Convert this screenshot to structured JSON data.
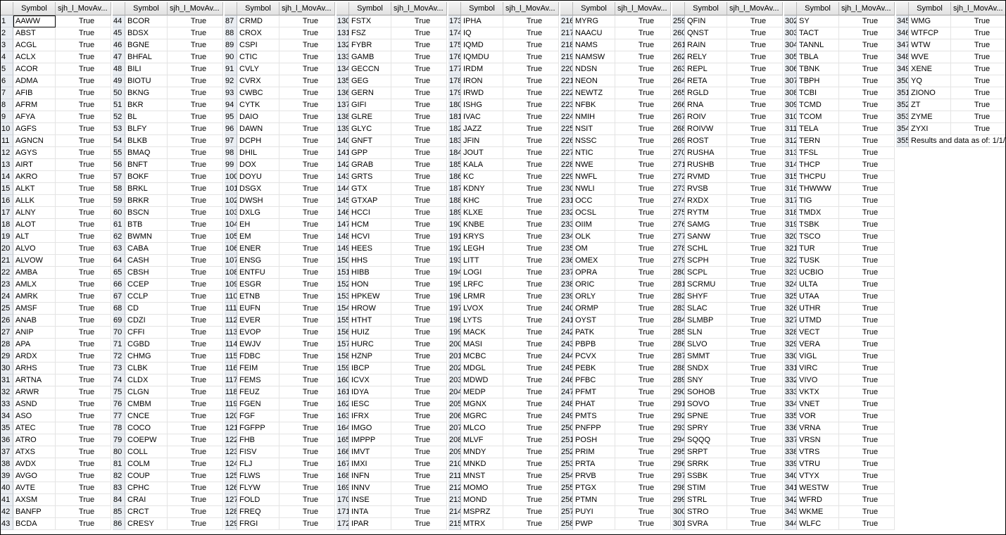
{
  "sheet": {
    "columns": {
      "symbol": "Symbol",
      "metric": "sjh_l_MovAv..."
    },
    "true_value": "True",
    "rows": [
      [
        "1",
        "AAWW"
      ],
      [
        "2",
        "ABST"
      ],
      [
        "3",
        "ACGL"
      ],
      [
        "4",
        "ACLX"
      ],
      [
        "5",
        "ACOR"
      ],
      [
        "6",
        "ADMA"
      ],
      [
        "7",
        "AFIB"
      ],
      [
        "8",
        "AFRM"
      ],
      [
        "9",
        "AFYA"
      ],
      [
        "10",
        "AGFS"
      ],
      [
        "11",
        "AGNCN"
      ],
      [
        "12",
        "AGYS"
      ],
      [
        "13",
        "AIRT"
      ],
      [
        "14",
        "AKRO"
      ],
      [
        "15",
        "ALKT"
      ],
      [
        "16",
        "ALLK"
      ],
      [
        "17",
        "ALNY"
      ],
      [
        "18",
        "ALOT"
      ],
      [
        "19",
        "ALT"
      ],
      [
        "20",
        "ALVO"
      ],
      [
        "21",
        "ALVOW"
      ],
      [
        "22",
        "AMBA"
      ],
      [
        "23",
        "AMLX"
      ],
      [
        "24",
        "AMRK"
      ],
      [
        "25",
        "AMSF"
      ],
      [
        "26",
        "ANAB"
      ],
      [
        "27",
        "ANIP"
      ],
      [
        "28",
        "APA"
      ],
      [
        "29",
        "ARDX"
      ],
      [
        "30",
        "ARHS"
      ],
      [
        "31",
        "ARTNA"
      ],
      [
        "32",
        "ARWR"
      ],
      [
        "33",
        "ASND"
      ],
      [
        "34",
        "ASO"
      ],
      [
        "35",
        "ATEC"
      ],
      [
        "36",
        "ATRO"
      ],
      [
        "37",
        "ATXS"
      ],
      [
        "38",
        "AVDX"
      ],
      [
        "39",
        "AVGO"
      ],
      [
        "40",
        "AVTE"
      ],
      [
        "41",
        "AXSM"
      ],
      [
        "42",
        "BANFP"
      ],
      [
        "43",
        "BCDA"
      ],
      [
        "44",
        "BCOR"
      ],
      [
        "45",
        "BDSX"
      ],
      [
        "46",
        "BGNE"
      ],
      [
        "47",
        "BHFAL"
      ],
      [
        "48",
        "BILI"
      ],
      [
        "49",
        "BIOTU"
      ],
      [
        "50",
        "BKNG"
      ],
      [
        "51",
        "BKR"
      ],
      [
        "52",
        "BL"
      ],
      [
        "53",
        "BLFY"
      ],
      [
        "54",
        "BLKB"
      ],
      [
        "55",
        "BMAQ"
      ],
      [
        "56",
        "BNFT"
      ],
      [
        "57",
        "BOKF"
      ],
      [
        "58",
        "BRKL"
      ],
      [
        "59",
        "BRKR"
      ],
      [
        "60",
        "BSCN"
      ],
      [
        "61",
        "BTB"
      ],
      [
        "62",
        "BWMN"
      ],
      [
        "63",
        "CABA"
      ],
      [
        "64",
        "CASH"
      ],
      [
        "65",
        "CBSH"
      ],
      [
        "66",
        "CCEP"
      ],
      [
        "67",
        "CCLP"
      ],
      [
        "68",
        "CD"
      ],
      [
        "69",
        "CDZI"
      ],
      [
        "70",
        "CFFI"
      ],
      [
        "71",
        "CGBD"
      ],
      [
        "72",
        "CHMG"
      ],
      [
        "73",
        "CLBK"
      ],
      [
        "74",
        "CLDX"
      ],
      [
        "75",
        "CLGN"
      ],
      [
        "76",
        "CMBM"
      ],
      [
        "77",
        "CNCE"
      ],
      [
        "78",
        "COCO"
      ],
      [
        "79",
        "COEPW"
      ],
      [
        "80",
        "COLL"
      ],
      [
        "81",
        "COLM"
      ],
      [
        "82",
        "COUP"
      ],
      [
        "83",
        "CPHC"
      ],
      [
        "84",
        "CRAI"
      ],
      [
        "85",
        "CRCT"
      ],
      [
        "86",
        "CRESY"
      ],
      [
        "87",
        "CRMD"
      ],
      [
        "88",
        "CROX"
      ],
      [
        "89",
        "CSPI"
      ],
      [
        "90",
        "CTIC"
      ],
      [
        "91",
        "CVLY"
      ],
      [
        "92",
        "CVRX"
      ],
      [
        "93",
        "CWBC"
      ],
      [
        "94",
        "CYTK"
      ],
      [
        "95",
        "DAIO"
      ],
      [
        "96",
        "DAWN"
      ],
      [
        "97",
        "DCPH"
      ],
      [
        "98",
        "DHIL"
      ],
      [
        "99",
        "DOX"
      ],
      [
        "100",
        "DOYU"
      ],
      [
        "101",
        "DSGX"
      ],
      [
        "102",
        "DWSH"
      ],
      [
        "103",
        "DXLG"
      ],
      [
        "104",
        "EH"
      ],
      [
        "105",
        "EM"
      ],
      [
        "106",
        "ENER"
      ],
      [
        "107",
        "ENSG"
      ],
      [
        "108",
        "ENTFU"
      ],
      [
        "109",
        "ESGR"
      ],
      [
        "110",
        "ETNB"
      ],
      [
        "111",
        "EUFN"
      ],
      [
        "112",
        "EVER"
      ],
      [
        "113",
        "EVOP"
      ],
      [
        "114",
        "EWJV"
      ],
      [
        "115",
        "FDBC"
      ],
      [
        "116",
        "FEIM"
      ],
      [
        "117",
        "FEMS"
      ],
      [
        "118",
        "FEUZ"
      ],
      [
        "119",
        "FGEN"
      ],
      [
        "120",
        "FGF"
      ],
      [
        "121",
        "FGFPP"
      ],
      [
        "122",
        "FHB"
      ],
      [
        "123",
        "FISV"
      ],
      [
        "124",
        "FLJ"
      ],
      [
        "125",
        "FLWS"
      ],
      [
        "126",
        "FLYW"
      ],
      [
        "127",
        "FOLD"
      ],
      [
        "128",
        "FREQ"
      ],
      [
        "129",
        "FRGI"
      ],
      [
        "130",
        "FSTX"
      ],
      [
        "131",
        "FSZ"
      ],
      [
        "132",
        "FYBR"
      ],
      [
        "133",
        "GAMB"
      ],
      [
        "134",
        "GECCN"
      ],
      [
        "135",
        "GEG"
      ],
      [
        "136",
        "GERN"
      ],
      [
        "137",
        "GIFI"
      ],
      [
        "138",
        "GLRE"
      ],
      [
        "139",
        "GLYC"
      ],
      [
        "140",
        "GNFT"
      ],
      [
        "141",
        "GPP"
      ],
      [
        "142",
        "GRAB"
      ],
      [
        "143",
        "GRTS"
      ],
      [
        "144",
        "GTX"
      ],
      [
        "145",
        "GTXAP"
      ],
      [
        "146",
        "HCCI"
      ],
      [
        "147",
        "HCM"
      ],
      [
        "148",
        "HCVI"
      ],
      [
        "149",
        "HEES"
      ],
      [
        "150",
        "HHS"
      ],
      [
        "151",
        "HIBB"
      ],
      [
        "152",
        "HON"
      ],
      [
        "153",
        "HPKEW"
      ],
      [
        "154",
        "HROW"
      ],
      [
        "155",
        "HTHT"
      ],
      [
        "156",
        "HUIZ"
      ],
      [
        "157",
        "HURC"
      ],
      [
        "158",
        "HZNP"
      ],
      [
        "159",
        "IBCP"
      ],
      [
        "160",
        "ICVX"
      ],
      [
        "161",
        "IDYA"
      ],
      [
        "162",
        "IESC"
      ],
      [
        "163",
        "IFRX"
      ],
      [
        "164",
        "IMGO"
      ],
      [
        "165",
        "IMPPP"
      ],
      [
        "166",
        "IMVT"
      ],
      [
        "167",
        "IMXI"
      ],
      [
        "168",
        "INFN"
      ],
      [
        "169",
        "INNV"
      ],
      [
        "170",
        "INSE"
      ],
      [
        "171",
        "INTA"
      ],
      [
        "172",
        "IPAR"
      ],
      [
        "173",
        "IPHA"
      ],
      [
        "174",
        "IQ"
      ],
      [
        "175",
        "IQMD"
      ],
      [
        "176",
        "IQMDU"
      ],
      [
        "177",
        "IRDM"
      ],
      [
        "178",
        "IRON"
      ],
      [
        "179",
        "IRWD"
      ],
      [
        "180",
        "ISHG"
      ],
      [
        "181",
        "IVAC"
      ],
      [
        "182",
        "JAZZ"
      ],
      [
        "183",
        "JFIN"
      ],
      [
        "184",
        "JOUT"
      ],
      [
        "185",
        "KALA"
      ],
      [
        "186",
        "KC"
      ],
      [
        "187",
        "KDNY"
      ],
      [
        "188",
        "KHC"
      ],
      [
        "189",
        "KLXE"
      ],
      [
        "190",
        "KNBE"
      ],
      [
        "191",
        "KRYS"
      ],
      [
        "192",
        "LEGH"
      ],
      [
        "193",
        "LITT"
      ],
      [
        "194",
        "LOGI"
      ],
      [
        "195",
        "LRFC"
      ],
      [
        "196",
        "LRMR"
      ],
      [
        "197",
        "LVOX"
      ],
      [
        "198",
        "LYTS"
      ],
      [
        "199",
        "MACK"
      ],
      [
        "200",
        "MASI"
      ],
      [
        "201",
        "MCBC"
      ],
      [
        "202",
        "MDGL"
      ],
      [
        "203",
        "MDWD"
      ],
      [
        "204",
        "MEDP"
      ],
      [
        "205",
        "MGNX"
      ],
      [
        "206",
        "MGRC"
      ],
      [
        "207",
        "MLCO"
      ],
      [
        "208",
        "MLVF"
      ],
      [
        "209",
        "MNDY"
      ],
      [
        "210",
        "MNKD"
      ],
      [
        "211",
        "MNST"
      ],
      [
        "212",
        "MOMO"
      ],
      [
        "213",
        "MOND"
      ],
      [
        "214",
        "MSPRZ"
      ],
      [
        "215",
        "MTRX"
      ],
      [
        "216",
        "MYRG"
      ],
      [
        "217",
        "NAACU"
      ],
      [
        "218",
        "NAMS"
      ],
      [
        "219",
        "NAMSW"
      ],
      [
        "220",
        "NDSN"
      ],
      [
        "221",
        "NEON"
      ],
      [
        "222",
        "NEWTZ"
      ],
      [
        "223",
        "NFBK"
      ],
      [
        "224",
        "NMIH"
      ],
      [
        "225",
        "NSIT"
      ],
      [
        "226",
        "NSSC"
      ],
      [
        "227",
        "NTIC"
      ],
      [
        "228",
        "NWE"
      ],
      [
        "229",
        "NWFL"
      ],
      [
        "230",
        "NWLI"
      ],
      [
        "231",
        "OCC"
      ],
      [
        "232",
        "OCSL"
      ],
      [
        "233",
        "OIIM"
      ],
      [
        "234",
        "OLK"
      ],
      [
        "235",
        "OM"
      ],
      [
        "236",
        "OMEX"
      ],
      [
        "237",
        "OPRA"
      ],
      [
        "238",
        "ORIC"
      ],
      [
        "239",
        "ORLY"
      ],
      [
        "240",
        "ORMP"
      ],
      [
        "241",
        "OYST"
      ],
      [
        "242",
        "PATK"
      ],
      [
        "243",
        "PBPB"
      ],
      [
        "244",
        "PCVX"
      ],
      [
        "245",
        "PEBK"
      ],
      [
        "246",
        "PFBC"
      ],
      [
        "247",
        "PFMT"
      ],
      [
        "248",
        "PHAT"
      ],
      [
        "249",
        "PMTS"
      ],
      [
        "250",
        "PNFPP"
      ],
      [
        "251",
        "POSH"
      ],
      [
        "252",
        "PRIM"
      ],
      [
        "253",
        "PRTA"
      ],
      [
        "254",
        "PRVB"
      ],
      [
        "255",
        "PTGX"
      ],
      [
        "256",
        "PTMN"
      ],
      [
        "257",
        "PUYI"
      ],
      [
        "258",
        "PWP"
      ],
      [
        "259",
        "QFIN"
      ],
      [
        "260",
        "QNST"
      ],
      [
        "261",
        "RAIN"
      ],
      [
        "262",
        "RELY"
      ],
      [
        "263",
        "REPL"
      ],
      [
        "264",
        "RETA"
      ],
      [
        "265",
        "RGLD"
      ],
      [
        "266",
        "RNA"
      ],
      [
        "267",
        "ROIV"
      ],
      [
        "268",
        "ROIVW"
      ],
      [
        "269",
        "ROST"
      ],
      [
        "270",
        "RUSHA"
      ],
      [
        "271",
        "RUSHB"
      ],
      [
        "272",
        "RVMD"
      ],
      [
        "273",
        "RVSB"
      ],
      [
        "274",
        "RXDX"
      ],
      [
        "275",
        "RYTM"
      ],
      [
        "276",
        "SAMG"
      ],
      [
        "277",
        "SANW"
      ],
      [
        "278",
        "SCHL"
      ],
      [
        "279",
        "SCPH"
      ],
      [
        "280",
        "SCPL"
      ],
      [
        "281",
        "SCRMU"
      ],
      [
        "282",
        "SHYF"
      ],
      [
        "283",
        "SLAC"
      ],
      [
        "284",
        "SLMBP"
      ],
      [
        "285",
        "SLN"
      ],
      [
        "286",
        "SLVO"
      ],
      [
        "287",
        "SMMT"
      ],
      [
        "288",
        "SNDX"
      ],
      [
        "289",
        "SNY"
      ],
      [
        "290",
        "SOHOB"
      ],
      [
        "291",
        "SOVO"
      ],
      [
        "292",
        "SPNE"
      ],
      [
        "293",
        "SPRY"
      ],
      [
        "294",
        "SQQQ"
      ],
      [
        "295",
        "SRPT"
      ],
      [
        "296",
        "SRRK"
      ],
      [
        "297",
        "SSBK"
      ],
      [
        "298",
        "STIM"
      ],
      [
        "299",
        "STRL"
      ],
      [
        "300",
        "STRO"
      ],
      [
        "301",
        "SVRA"
      ],
      [
        "302",
        "SY"
      ],
      [
        "303",
        "TACT"
      ],
      [
        "304",
        "TANNL"
      ],
      [
        "305",
        "TBLA"
      ],
      [
        "306",
        "TBNK"
      ],
      [
        "307",
        "TBPH"
      ],
      [
        "308",
        "TCBI"
      ],
      [
        "309",
        "TCMD"
      ],
      [
        "310",
        "TCOM"
      ],
      [
        "311",
        "TELA"
      ],
      [
        "312",
        "TERN"
      ],
      [
        "313",
        "TFSL"
      ],
      [
        "314",
        "THCP"
      ],
      [
        "315",
        "THCPU"
      ],
      [
        "316",
        "THWWW"
      ],
      [
        "317",
        "TIG"
      ],
      [
        "318",
        "TMDX"
      ],
      [
        "319",
        "TSBK"
      ],
      [
        "320",
        "TSCO"
      ],
      [
        "321",
        "TUR"
      ],
      [
        "322",
        "TUSK"
      ],
      [
        "323",
        "UCBIO"
      ],
      [
        "324",
        "ULTA"
      ],
      [
        "325",
        "UTAA"
      ],
      [
        "326",
        "UTHR"
      ],
      [
        "327",
        "UTMD"
      ],
      [
        "328",
        "VECT"
      ],
      [
        "329",
        "VERA"
      ],
      [
        "330",
        "VIGL"
      ],
      [
        "331",
        "VIRC"
      ],
      [
        "332",
        "VIVO"
      ],
      [
        "333",
        "VKTX"
      ],
      [
        "334",
        "VNET"
      ],
      [
        "335",
        "VOR"
      ],
      [
        "336",
        "VRNA"
      ],
      [
        "337",
        "VRSN"
      ],
      [
        "338",
        "VTRS"
      ],
      [
        "339",
        "VTRU"
      ],
      [
        "340",
        "VTYX"
      ],
      [
        "341",
        "WESTW"
      ],
      [
        "342",
        "WFRD"
      ],
      [
        "343",
        "WKME"
      ],
      [
        "344",
        "WLFC"
      ],
      [
        "345",
        "WMG"
      ],
      [
        "346",
        "WTFCP"
      ],
      [
        "347",
        "WTW"
      ],
      [
        "348",
        "WVE"
      ],
      [
        "349",
        "XENE"
      ],
      [
        "350",
        "YQ"
      ],
      [
        "351",
        "ZIONO"
      ],
      [
        "352",
        "ZT"
      ],
      [
        "353",
        "ZYME"
      ],
      [
        "354",
        "ZYXI"
      ]
    ],
    "footer": {
      "index": "355",
      "note": "Results and data as of: 1/1/"
    }
  }
}
